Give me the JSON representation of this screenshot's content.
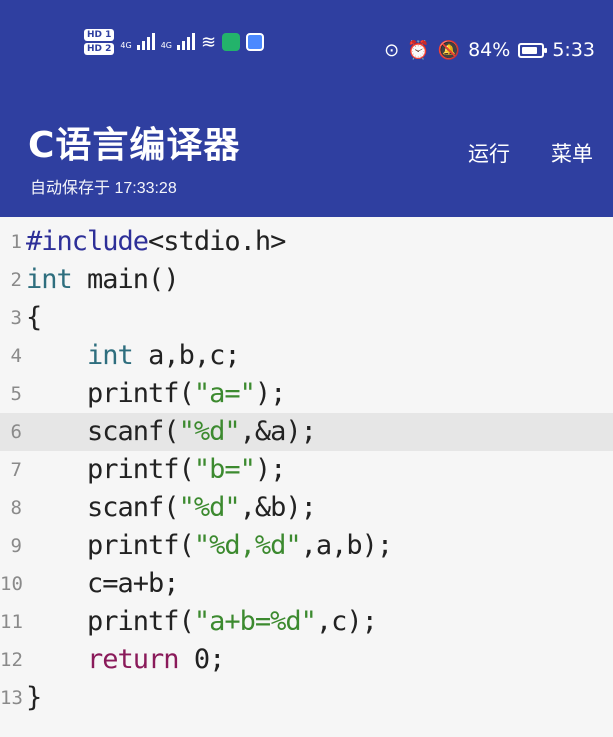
{
  "status_bar": {
    "hd1": "HD 1",
    "hd2": "HD 2",
    "network1": "4G",
    "network2": "4G",
    "battery_percent": "84%",
    "battery_level": 0.84,
    "time": "5:33"
  },
  "app_bar": {
    "title": "C语言编译器",
    "subtitle": "自动保存于 17:33:28",
    "run_label": "运行",
    "menu_label": "菜单",
    "background": "#2f3fa0"
  },
  "editor": {
    "active_line": 6,
    "lines": [
      {
        "n": "1",
        "parts": [
          [
            "inc",
            "#include"
          ],
          [
            "",
            "<stdio.h>"
          ]
        ]
      },
      {
        "n": "2",
        "parts": [
          [
            "kw",
            "int"
          ],
          [
            "",
            " main()"
          ]
        ]
      },
      {
        "n": "3",
        "parts": [
          [
            "",
            "{"
          ]
        ]
      },
      {
        "n": "4",
        "parts": [
          [
            "",
            "    "
          ],
          [
            "kw",
            "int"
          ],
          [
            "",
            " a,b,c;"
          ]
        ]
      },
      {
        "n": "5",
        "parts": [
          [
            "",
            "    printf("
          ],
          [
            "str",
            "\"a=\""
          ],
          [
            "",
            ");"
          ]
        ]
      },
      {
        "n": "6",
        "parts": [
          [
            "",
            "    scanf("
          ],
          [
            "str",
            "\"%d\""
          ],
          [
            "",
            ",&a);"
          ]
        ]
      },
      {
        "n": "7",
        "parts": [
          [
            "",
            "    printf("
          ],
          [
            "str",
            "\"b=\""
          ],
          [
            "",
            ");"
          ]
        ]
      },
      {
        "n": "8",
        "parts": [
          [
            "",
            "    scanf("
          ],
          [
            "str",
            "\"%d\""
          ],
          [
            "",
            ",&b);"
          ]
        ]
      },
      {
        "n": "9",
        "parts": [
          [
            "",
            "    printf("
          ],
          [
            "str",
            "\"%d,%d\""
          ],
          [
            "",
            ",a,b);"
          ]
        ]
      },
      {
        "n": "10",
        "parts": [
          [
            "",
            "    c=a+b;"
          ]
        ]
      },
      {
        "n": "11",
        "parts": [
          [
            "",
            "    printf("
          ],
          [
            "str",
            "\"a+b=%d\""
          ],
          [
            "",
            ",c);"
          ]
        ]
      },
      {
        "n": "12",
        "parts": [
          [
            "",
            "    "
          ],
          [
            "ret",
            "return"
          ],
          [
            "",
            " 0;"
          ]
        ]
      },
      {
        "n": "13",
        "parts": [
          [
            "",
            "}"
          ]
        ]
      }
    ]
  }
}
